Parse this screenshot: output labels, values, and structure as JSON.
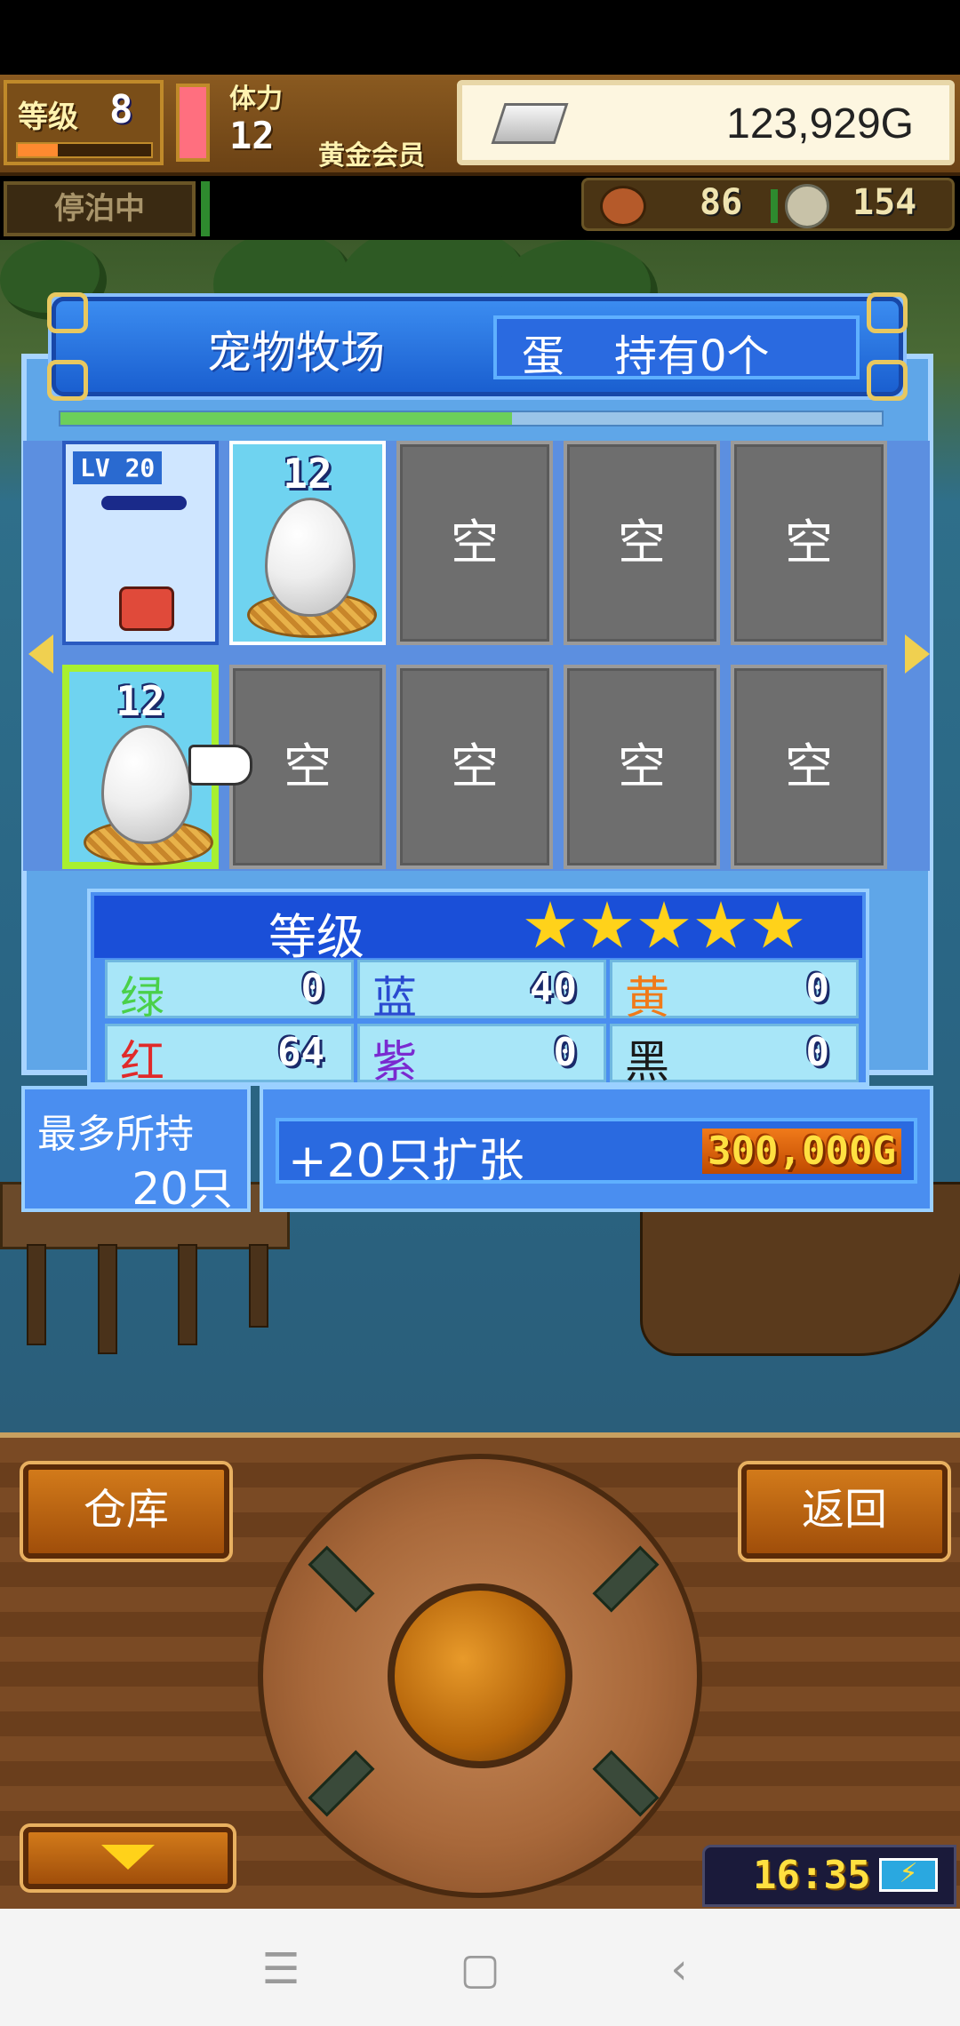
{
  "hud": {
    "level_label": "等级",
    "level": "8",
    "stamina_label": "体力",
    "stamina": "12",
    "membership": "黄金会员",
    "gold": "123,929G",
    "dock_status": "停泊中",
    "resource_a": "86",
    "resource_b": "154"
  },
  "ranch": {
    "title": "宠物牧场",
    "egg_label": "蛋",
    "egg_count": "持有0个",
    "progress": 0.55,
    "slots": [
      {
        "type": "pet",
        "level": "LV 20"
      },
      {
        "type": "egg",
        "level": "12"
      },
      {
        "type": "empty",
        "label": "空"
      },
      {
        "type": "empty",
        "label": "空"
      },
      {
        "type": "empty",
        "label": "空"
      },
      {
        "type": "egg",
        "level": "12",
        "selected": true
      },
      {
        "type": "empty",
        "label": "空"
      },
      {
        "type": "empty",
        "label": "空"
      },
      {
        "type": "empty",
        "label": "空"
      },
      {
        "type": "empty",
        "label": "空"
      }
    ]
  },
  "stats": {
    "title": "等级",
    "stars": 5,
    "items": [
      {
        "name": "绿",
        "value": "0",
        "color": "#4ad04a"
      },
      {
        "name": "蓝",
        "value": "40",
        "color": "#2a4ad0"
      },
      {
        "name": "黄",
        "value": "0",
        "color": "#f07a1a"
      },
      {
        "name": "红",
        "value": "64",
        "color": "#e02a2a"
      },
      {
        "name": "紫",
        "value": "0",
        "color": "#7a2ad0"
      },
      {
        "name": "黑",
        "value": "0",
        "color": "#1a1a1a"
      }
    ]
  },
  "capacity": {
    "label": "最多所持",
    "value": "20只"
  },
  "expand": {
    "label": "+20只扩张",
    "cost": "300,000G"
  },
  "controls": {
    "storage_label": "仓库",
    "back_label": "返回"
  },
  "clock": "16:35",
  "navbar": {
    "menu_icon": "☰",
    "home_icon": "▢",
    "back_icon": "‹"
  }
}
